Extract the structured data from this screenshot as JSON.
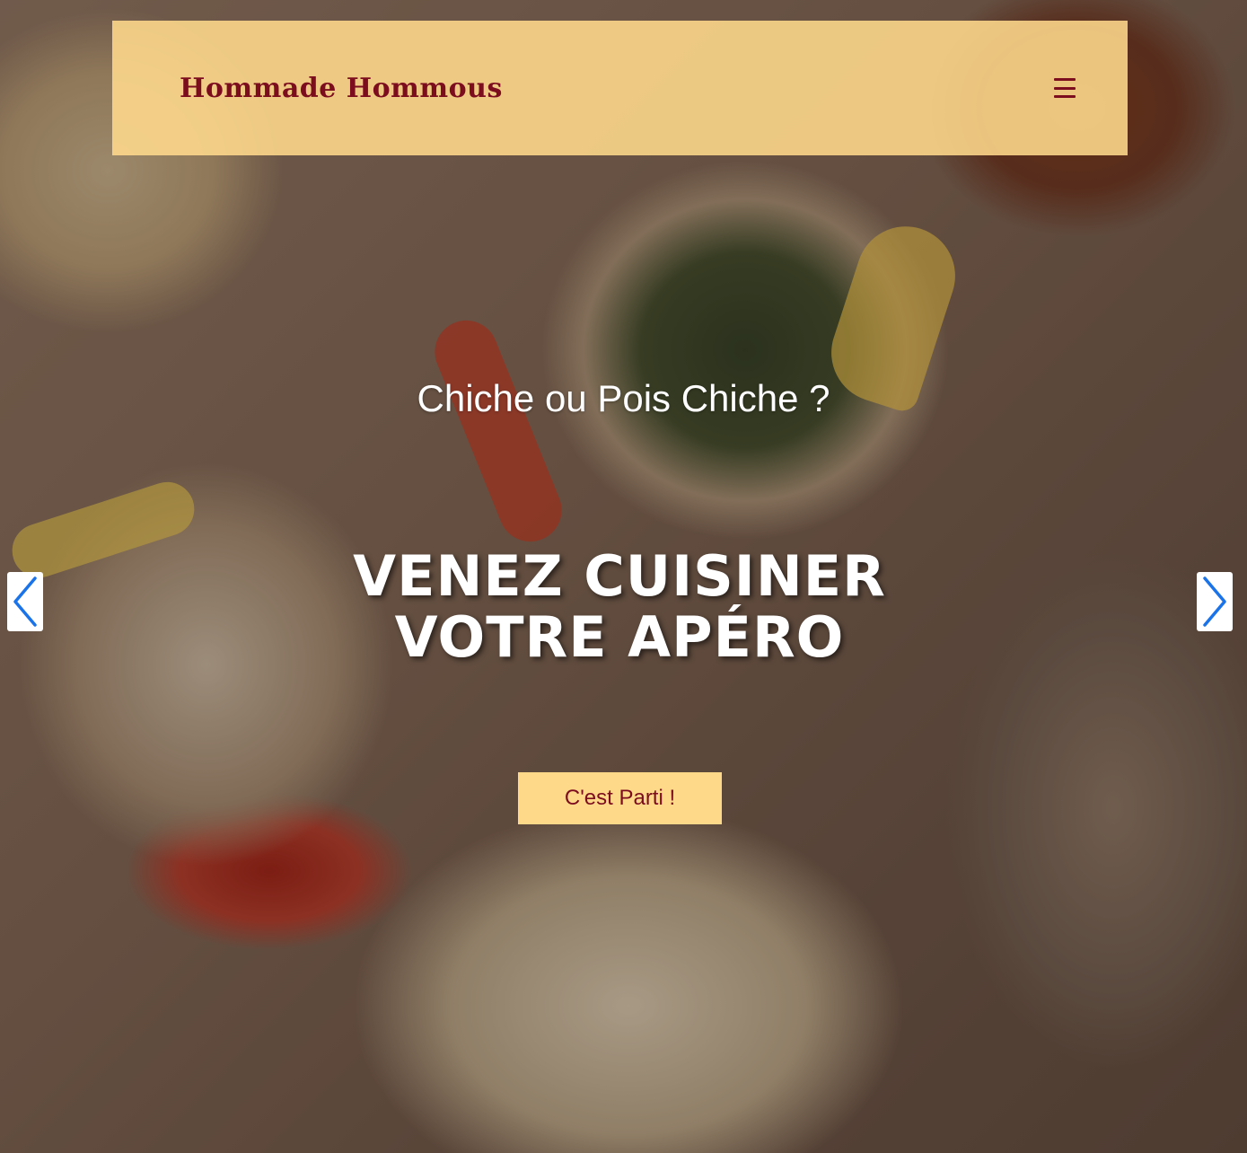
{
  "navbar": {
    "brand": "Hommade Hommous",
    "menu_icon": "hamburger-menu-icon"
  },
  "hero": {
    "subtitle": "Chiche ou Pois Chiche ?",
    "headline": "VENEZ CUISINER VOTRE APÉRO",
    "cta_label": "C'est Parti !"
  },
  "carousel": {
    "prev_icon": "chevron-left-icon",
    "next_icon": "chevron-right-icon"
  },
  "colors": {
    "navbar_bg": "#ffd98a",
    "brand": "#7c0d1f",
    "arrow": "#1a73e8"
  }
}
